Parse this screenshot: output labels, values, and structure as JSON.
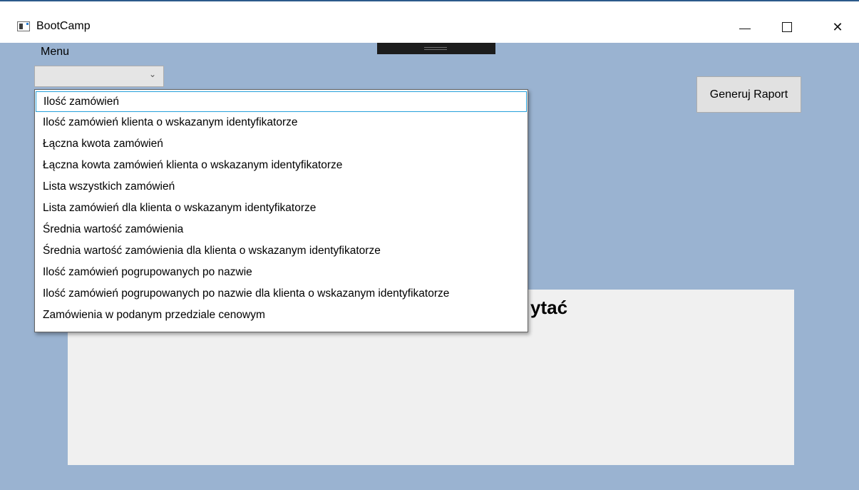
{
  "window": {
    "title": "BootCamp",
    "icons": [
      "app-icon",
      "minimize-icon",
      "maximize-icon",
      "close-icon"
    ],
    "close_glyph": "✕"
  },
  "menu": {
    "label": "Menu",
    "selected": "",
    "arrow_glyph": "⌄",
    "options": [
      "Ilość zamówień",
      "Ilość zamówień klienta o wskazanym identyfikatorze",
      "Łączna kwota zamówień",
      "Łączna kowta zamówień klienta o wskazanym identyfikatorze",
      "Lista wszystkich zamówień",
      "Lista zamówień dla klienta o wskazanym identyfikatorze",
      "Średnia wartość zamówienia",
      "Średnia wartość zamówienia dla klienta o wskazanym identyfikatorze",
      "Ilość zamówień pogrupowanych po nazwie",
      "Ilość zamówień pogrupowanych po nazwie dla klienta o wskazanym identyfikatorze",
      "Zamówienia w podanym przedziale cenowym"
    ]
  },
  "actions": {
    "generate_report_label": "Generuj Raport"
  },
  "result_panel": {
    "text_visible": "ytać"
  },
  "colors": {
    "background": "#9ab3d1",
    "panel": "#f0f0f0",
    "focus_border": "#26a0da"
  }
}
